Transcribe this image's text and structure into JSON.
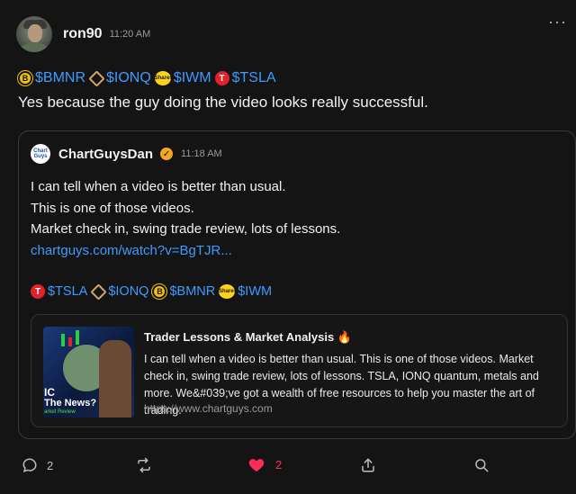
{
  "post": {
    "username": "ron90",
    "time": "11:20 AM",
    "more_label": "···",
    "tickers": [
      {
        "icon": "bmnr-icon",
        "glyph": "B",
        "symbol": "$BMNR"
      },
      {
        "icon": "ionq-icon",
        "glyph": "",
        "symbol": "$IONQ"
      },
      {
        "icon": "iwm-icon",
        "glyph": "iShares",
        "symbol": "$IWM"
      },
      {
        "icon": "tsla-icon",
        "glyph": "T",
        "symbol": "$TSLA"
      }
    ],
    "text": "Yes because the guy doing the video looks really successful."
  },
  "quote": {
    "avatar_text": "Chart Guys",
    "name": "ChartGuysDan",
    "verified_glyph": "✓",
    "time": "11:18 AM",
    "lines": [
      "I can tell when a video is better than usual.",
      "This is one of those videos.",
      "Market check in, swing trade review, lots of lessons."
    ],
    "link": "chartguys.com/watch?v=BgTJR...",
    "tickers": [
      {
        "icon": "tsla-icon",
        "glyph": "T",
        "symbol": "$TSLA"
      },
      {
        "icon": "ionq-icon",
        "glyph": "",
        "symbol": "$IONQ"
      },
      {
        "icon": "bmnr-icon",
        "glyph": "B",
        "symbol": "$BMNR"
      },
      {
        "icon": "iwm-icon",
        "glyph": "iShares",
        "symbol": "$IWM"
      }
    ],
    "card": {
      "thumb_text_1": "IC",
      "thumb_text_2": "The News?",
      "thumb_text_3": "arket Review",
      "title": "Trader Lessons & Market Analysis 🔥",
      "description": "I can tell when a video is better than usual. This is one of those videos. Market check in, swing trade review, lots of lessons. TSLA, IONQ quantum, metals and more. We&#039;ve got a wealth of free resources to help you master the art of trading.",
      "url": "https://www.chartguys.com"
    }
  },
  "actions": {
    "comments": "2",
    "likes": "2"
  },
  "colors": {
    "link": "#3e9bff",
    "like": "#ff2d55",
    "verified": "#f5a623"
  }
}
